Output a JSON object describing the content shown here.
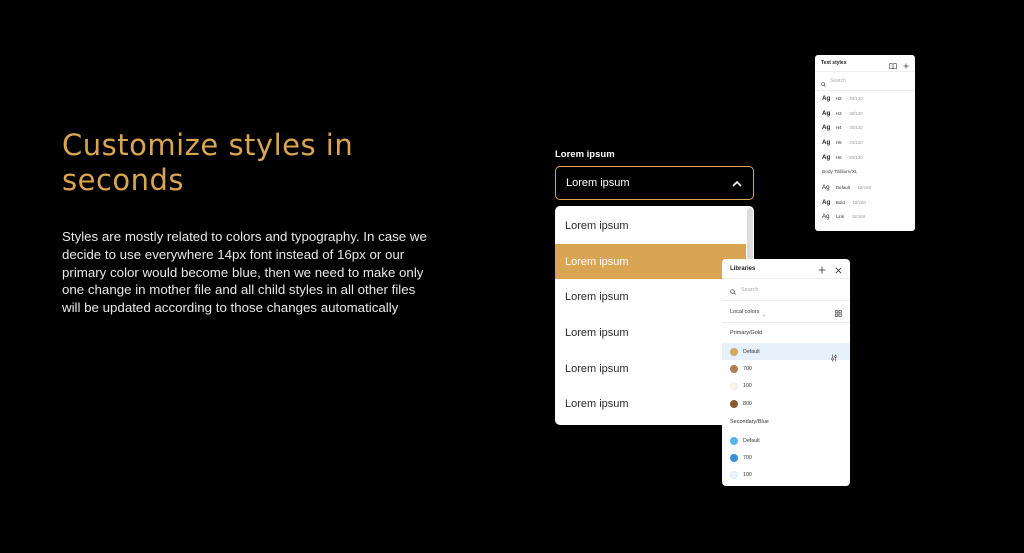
{
  "hero": {
    "headline": "Customize styles in seconds",
    "description": "Styles are mostly related to colors and typography. In case we decide to use everywhere 14px font instead of 16px or our primary color would become blue, then we need to make only one change in mother file and all child styles in all other files will be updated according to those changes automatically"
  },
  "colors": {
    "accent": "#d9a552",
    "background": "#000000"
  },
  "dropdown": {
    "label": "Lorem ipsum",
    "selected": "Lorem ipsum",
    "chevron_icon": "chevron-up-icon",
    "options": [
      "Lorem ipsum",
      "Lorem ipsum",
      "Lorem ipsum",
      "Lorem ipsum",
      "Lorem ipsum",
      "Lorem ipsum"
    ],
    "active_index": 1
  },
  "text_styles": {
    "title": "Text styles",
    "search_placeholder": "Search",
    "icons": [
      "book-icon",
      "plus-icon"
    ],
    "headings": [
      {
        "sample": "Ag",
        "name": "H2",
        "size": "· 40/120"
      },
      {
        "sample": "Ag",
        "name": "H3",
        "size": "· 36/120"
      },
      {
        "sample": "Ag",
        "name": "H4",
        "size": "· 30/120"
      },
      {
        "sample": "Ag",
        "name": "H5",
        "size": "· 24/120"
      },
      {
        "sample": "Ag",
        "name": "H6",
        "size": "· 20/120"
      }
    ],
    "group": "Body Titillium/XL",
    "body": [
      {
        "sample": "Ag",
        "name": "Default",
        "size": "· 18/160"
      },
      {
        "sample": "Ag",
        "name": "Bold",
        "size": "· 18/160"
      },
      {
        "sample": "Ag",
        "name": "Link",
        "size": "· 18/160"
      }
    ]
  },
  "libraries": {
    "title": "Libraries",
    "search_placeholder": "Search",
    "local_label": "Local colors",
    "primary_group": "Primary/Gold",
    "primary": [
      {
        "name": "Default",
        "color": "#d4a763"
      },
      {
        "name": "700",
        "color": "#b07f4d"
      },
      {
        "name": "100",
        "color": "#fbf3e3"
      },
      {
        "name": "800",
        "color": "#8a5a2e"
      }
    ],
    "secondary_group": "Secondary/Blue",
    "secondary": [
      {
        "name": "Default",
        "color": "#56b4ea"
      },
      {
        "name": "700",
        "color": "#3a8fd6"
      },
      {
        "name": "100",
        "color": "#e7f5fc"
      }
    ]
  }
}
